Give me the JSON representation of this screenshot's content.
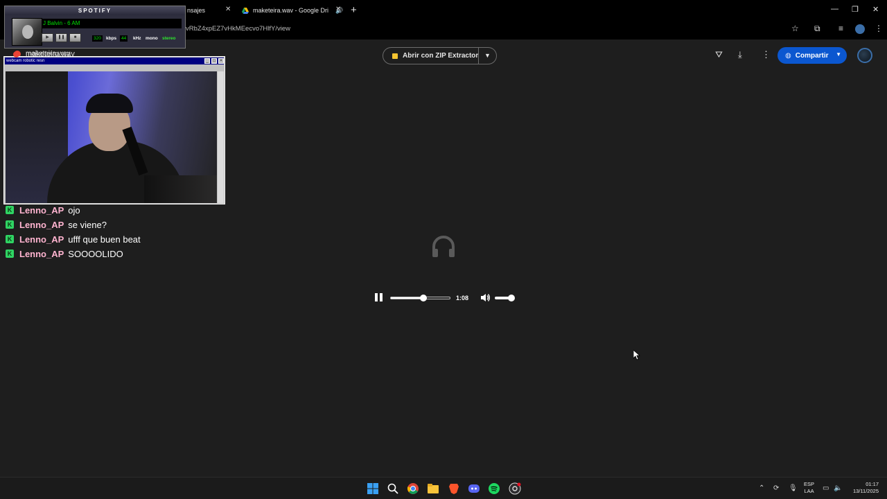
{
  "browser": {
    "tabs": [
      {
        "label": "nsajes"
      },
      {
        "label": "maketeira.wav - Google Dri"
      }
    ],
    "address": "vRbZ4xpEZ7vHkMEecvo7HlfY/view"
  },
  "drive": {
    "filename": "maketeira.wav",
    "zip_button": "Abrir con ZIP Extractor",
    "share_button": "Compartir"
  },
  "player": {
    "time": "1:08",
    "progress_fraction": 0.55,
    "volume_fraction": 1.0
  },
  "spotify": {
    "title": "SPOTIFY",
    "track": "J Balvin - 6 AM",
    "bitrate": "320",
    "bitrate_unit": "kbps",
    "samplerate": "44",
    "samplerate_unit": "kHz",
    "mono": "mono",
    "stereo": "stereo"
  },
  "webcam": {
    "title": "webcam robotic resn"
  },
  "chat": [
    {
      "user": "Lenno_AP",
      "message": "ojo"
    },
    {
      "user": "Lenno_AP",
      "message": "se viene?"
    },
    {
      "user": "Lenno_AP",
      "message": "ufff que buen beat"
    },
    {
      "user": "Lenno_AP",
      "message": "SOOOOLIDO"
    }
  ],
  "taskbar": {
    "lang_line1": "ESP",
    "lang_line2": "LAA",
    "time": "01:17",
    "date": "13/11/2025"
  }
}
